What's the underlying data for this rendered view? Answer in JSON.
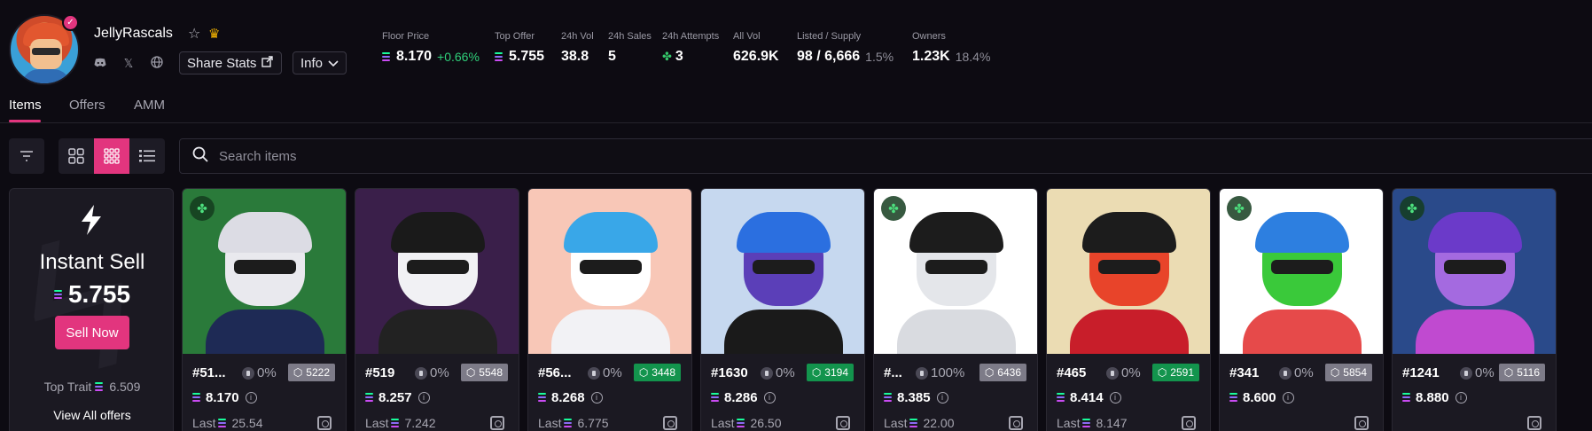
{
  "collection": {
    "name": "JellyRascals",
    "share_label": "Share Stats",
    "info_label": "Info"
  },
  "stats": [
    {
      "label": "Floor Price",
      "value": "8.170",
      "change": "+0.66%",
      "sol": true
    },
    {
      "label": "Top Offer",
      "value": "5.755",
      "sol": true
    },
    {
      "label": "24h Vol",
      "value": "38.8"
    },
    {
      "label": "24h Sales",
      "value": "5"
    },
    {
      "label": "24h Attempts",
      "value": "3",
      "clover": true
    },
    {
      "label": "All Vol",
      "value": "626.9K"
    },
    {
      "label": "Listed / Supply",
      "value": "98 / 6,666",
      "sub": "1.5%"
    },
    {
      "label": "Owners",
      "value": "1.23K",
      "sub": "18.4%"
    }
  ],
  "tabs": [
    "Items",
    "Offers",
    "AMM"
  ],
  "search": {
    "placeholder": "Search items"
  },
  "instant_sell": {
    "title": "Instant Sell",
    "price": "5.755",
    "button": "Sell Now",
    "top_trait_label": "Top Trait",
    "top_trait_value": "6.509",
    "view_all": "View All offers"
  },
  "items": [
    {
      "name": "#51...",
      "pct": "0%",
      "rank": "5222",
      "rank_color": "gray",
      "price": "8.170",
      "last": "Last",
      "last_value": "25.54",
      "lucky": true,
      "bg": "#2a7a3a",
      "skin": "#e9e9ee",
      "hair": "#dcdce4",
      "body": "#1e2a55"
    },
    {
      "name": "#519",
      "pct": "0%",
      "rank": "5548",
      "rank_color": "gray",
      "price": "8.257",
      "last": "Last",
      "last_value": "7.242",
      "lucky": false,
      "bg": "#3a1f4a",
      "skin": "#f1f1f4",
      "hair": "#1a1a1a",
      "body": "#222"
    },
    {
      "name": "#56...",
      "pct": "0%",
      "rank": "3448",
      "rank_color": "green",
      "price": "8.268",
      "last": "Last",
      "last_value": "6.775",
      "lucky": false,
      "bg": "#f8c7b7",
      "skin": "#ffffff",
      "hair": "#39a7e8",
      "body": "#f2f2f5"
    },
    {
      "name": "#1630",
      "pct": "0%",
      "rank": "3194",
      "rank_color": "green",
      "price": "8.286",
      "last": "Last",
      "last_value": "26.50",
      "lucky": false,
      "bg": "#c6d8ef",
      "skin": "#5b3fb8",
      "hair": "#2b6fe0",
      "body": "#1a1a1a"
    },
    {
      "name": "#...",
      "pct": "100%",
      "rank": "6436",
      "rank_color": "gray",
      "price": "8.385",
      "last": "Last",
      "last_value": "22.00",
      "lucky": true,
      "bg": "#ffffff",
      "skin": "#e4e6ea",
      "hair": "#1c1c1c",
      "body": "#d9dbe0"
    },
    {
      "name": "#465",
      "pct": "0%",
      "rank": "2591",
      "rank_color": "green",
      "price": "8.414",
      "last": "Last",
      "last_value": "8.147",
      "lucky": false,
      "bg": "#ebdcb3",
      "skin": "#e8442a",
      "hair": "#1c1c1c",
      "body": "#c81e2a"
    },
    {
      "name": "#341",
      "pct": "0%",
      "rank": "5854",
      "rank_color": "gray",
      "price": "8.600",
      "last": "",
      "last_value": "",
      "lucky": true,
      "bg": "#ffffff",
      "skin": "#3ac93a",
      "hair": "#2d7fe0",
      "body": "#e64a4a"
    },
    {
      "name": "#1241",
      "pct": "0%",
      "rank": "5116",
      "rank_color": "gray",
      "price": "8.880",
      "last": "",
      "last_value": "",
      "lucky": true,
      "bg": "#2a4a8a",
      "skin": "#a46ae0",
      "hair": "#6b3ac9",
      "body": "#c04ad0"
    }
  ]
}
